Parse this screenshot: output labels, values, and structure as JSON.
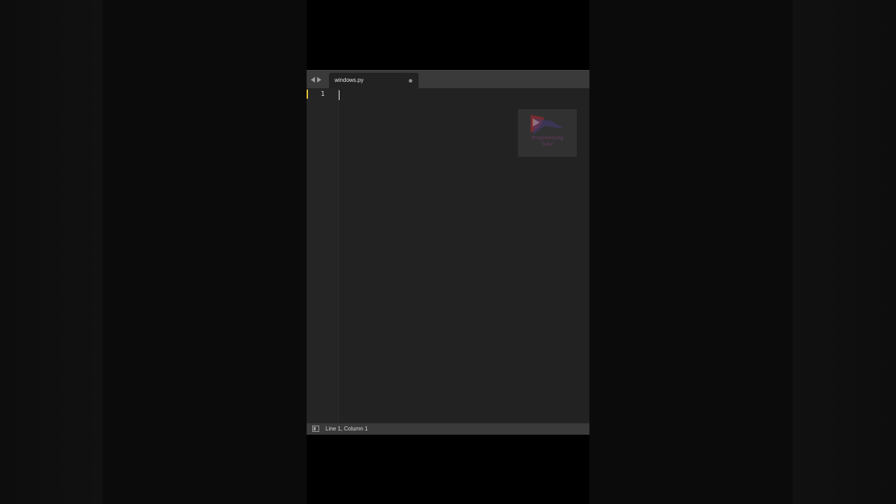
{
  "editor": {
    "tab": {
      "filename": "windows.py",
      "modified": true
    },
    "gutter": {
      "line_numbers": [
        "1"
      ]
    },
    "status": {
      "position": "Line 1, Column 1"
    },
    "watermark": {
      "line1": "Programming",
      "line2": "Tube"
    }
  },
  "colors": {
    "editor_bg": "#222222",
    "tabbar_bg": "#3a3a3a",
    "active_line_marker": "#e8c43a",
    "text": "#e6e6e6"
  },
  "icons": {
    "nav_back": "triangle-left",
    "nav_forward": "triangle-right",
    "unsaved": "dot",
    "panel_toggle": "sidebar-square"
  }
}
